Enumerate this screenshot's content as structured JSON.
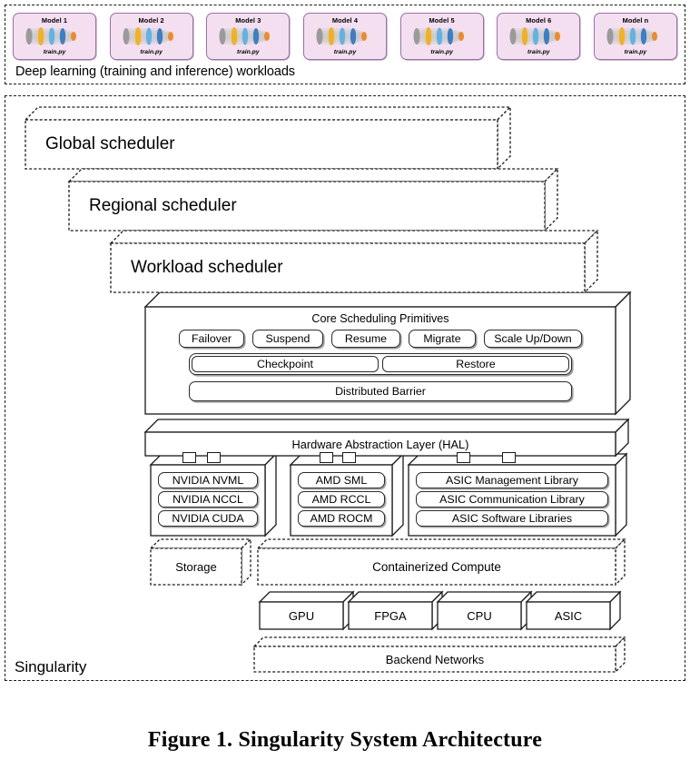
{
  "workloads": {
    "caption": "Deep learning (training and inference) workloads",
    "script_label": "train.py",
    "models": [
      {
        "title": "Model 1"
      },
      {
        "title": "Model 2"
      },
      {
        "title": "Model 3"
      },
      {
        "title": "Model 4"
      },
      {
        "title": "Model 5"
      },
      {
        "title": "Model 6"
      },
      {
        "title": "Model n"
      }
    ],
    "card_bg": "#f4dff1",
    "card_border": "#9b6fa8"
  },
  "singularity": {
    "label": "Singularity",
    "schedulers": [
      {
        "label": "Global scheduler"
      },
      {
        "label": "Regional scheduler"
      },
      {
        "label": "Workload scheduler"
      }
    ],
    "core_primitives": {
      "title": "Core Scheduling Primitives",
      "row1": [
        "Failover",
        "Suspend",
        "Resume",
        "Migrate",
        "Scale Up/Down"
      ],
      "row2": [
        "Checkpoint",
        "Restore"
      ],
      "row3": [
        "Distributed Barrier"
      ]
    },
    "hal": {
      "label": "Hardware Abstraction Layer (HAL)"
    },
    "vendors": [
      {
        "name": "nvidia",
        "items": [
          "NVIDIA NVML",
          "NVIDIA NCCL",
          "NVIDIA CUDA"
        ]
      },
      {
        "name": "amd",
        "items": [
          "AMD SML",
          "AMD RCCL",
          "AMD ROCM"
        ]
      },
      {
        "name": "asic",
        "items": [
          "ASIC Management Library",
          "ASIC Communication Library",
          "ASIC Software Libraries"
        ]
      }
    ],
    "storage": {
      "label": "Storage"
    },
    "compute": {
      "label": "Containerized Compute"
    },
    "hardware": [
      {
        "label": "GPU"
      },
      {
        "label": "FPGA"
      },
      {
        "label": "CPU"
      },
      {
        "label": "ASIC"
      }
    ],
    "network": {
      "label": "Backend Networks"
    }
  },
  "figure": {
    "caption": "Figure 1. Singularity System Architecture"
  }
}
